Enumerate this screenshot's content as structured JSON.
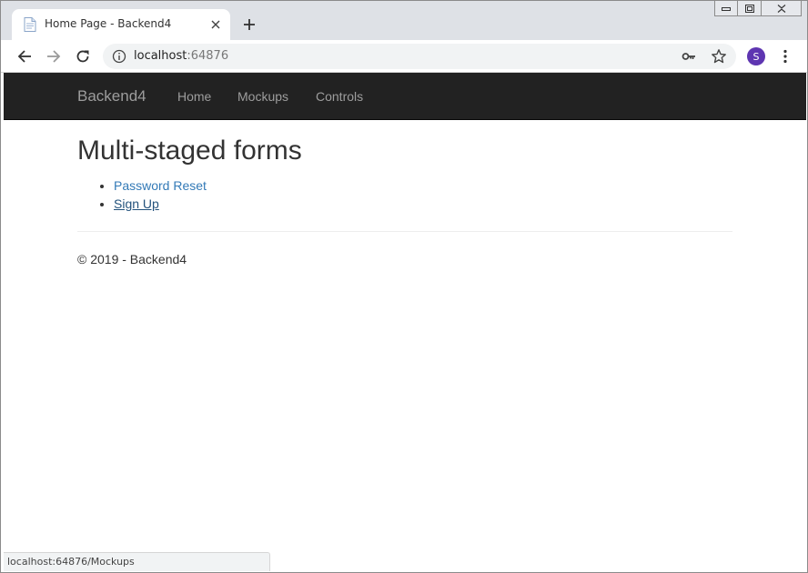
{
  "browser": {
    "tab": {
      "title": "Home Page - Backend4",
      "favicon": "page-icon"
    },
    "address_bar": {
      "host": "localhost",
      "port": ":64876"
    },
    "profile_initial": "S",
    "status_url": "localhost:64876/Mockups",
    "window_controls": [
      "minimize",
      "restore",
      "close"
    ]
  },
  "site": {
    "brand": "Backend4",
    "nav": [
      {
        "label": "Home"
      },
      {
        "label": "Mockups"
      },
      {
        "label": "Controls"
      }
    ],
    "heading": "Multi-staged forms",
    "links": [
      {
        "label": "Password Reset",
        "state": "normal"
      },
      {
        "label": "Sign Up",
        "state": "hover"
      }
    ],
    "footer": "© 2019 - Backend4"
  },
  "colors": {
    "navbar_bg": "#222222",
    "nav_text": "#9d9d9d",
    "link": "#337ab7",
    "link_hover": "#23527c",
    "avatar": "#5e35b1",
    "tabstrip": "#dee1e6"
  }
}
